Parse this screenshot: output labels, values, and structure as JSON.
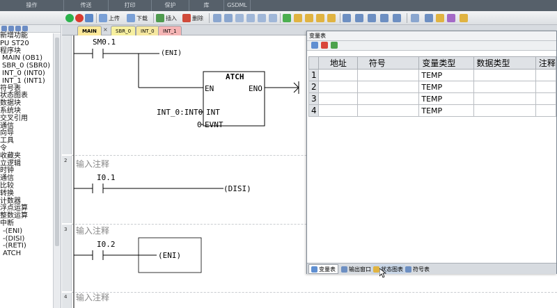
{
  "ribbon": {
    "groups": [
      "操作",
      "传送",
      "打印",
      "保护",
      "库",
      "GSDML"
    ]
  },
  "toolbar": {
    "upload": "上传",
    "download": "下载",
    "insert": "插入",
    "delete": "删除"
  },
  "tree": {
    "items": [
      "新增功能",
      "PU ST20",
      "程序块",
      "MAIN (OB1)",
      "SBR_0 (SBR0)",
      "INT_0 (INT0)",
      "INT_1 (INT1)",
      "符号表",
      "状态图表",
      "数据块",
      "系统块",
      "交叉引用",
      "通信",
      "向导",
      "工具",
      "令",
      "收藏夹",
      "立逻辑",
      "时钟",
      "通信",
      "比较",
      "转换",
      "计数器",
      "浮点运算",
      "整数运算",
      "中断",
      "-(ENI)",
      "-(DISI)",
      "-(RETI)",
      "ATCH"
    ]
  },
  "tabs": {
    "main": "MAIN",
    "sbr0": "SBR_0",
    "int0": "INT_0",
    "int1": "INT_1",
    "main_color": "#fde99a",
    "sbr0_color": "#f7f0a0",
    "int0_color": "#f6e8a0",
    "int1_color": "#f5b5b5"
  },
  "ladder": {
    "net1": {
      "contact": "SM0.1",
      "coil": "ENI",
      "box_name": "ATCH",
      "en": "EN",
      "eno": "ENO",
      "int_pin": "INT",
      "evnt_pin": "EVNT",
      "int_value": "INT_0:INT0",
      "evnt_value": "0"
    },
    "net2": {
      "number": "2",
      "comment": "输入注释",
      "contact": "I0.1",
      "coil": "DISI"
    },
    "net3": {
      "number": "3",
      "comment": "输入注释",
      "contact": "I0.2",
      "coil": "ENI"
    },
    "net4": {
      "number": "4",
      "comment": "输入注释"
    }
  },
  "vartable": {
    "title": "变量表",
    "headers": [
      "地址",
      "符号",
      "变量类型",
      "数据类型",
      "注释"
    ],
    "rows": [
      {
        "num": "1",
        "address": "",
        "symbol": "",
        "var_type": "TEMP",
        "data_type": "",
        "comment": ""
      },
      {
        "num": "2",
        "address": "",
        "symbol": "",
        "var_type": "TEMP",
        "data_type": "",
        "comment": ""
      },
      {
        "num": "3",
        "address": "",
        "symbol": "",
        "var_type": "TEMP",
        "data_type": "",
        "comment": ""
      },
      {
        "num": "4",
        "address": "",
        "symbol": "",
        "var_type": "TEMP",
        "data_type": "",
        "comment": ""
      }
    ],
    "bottom_tabs": [
      "变量表",
      "输出窗口",
      "状态图表",
      "符号表"
    ]
  }
}
